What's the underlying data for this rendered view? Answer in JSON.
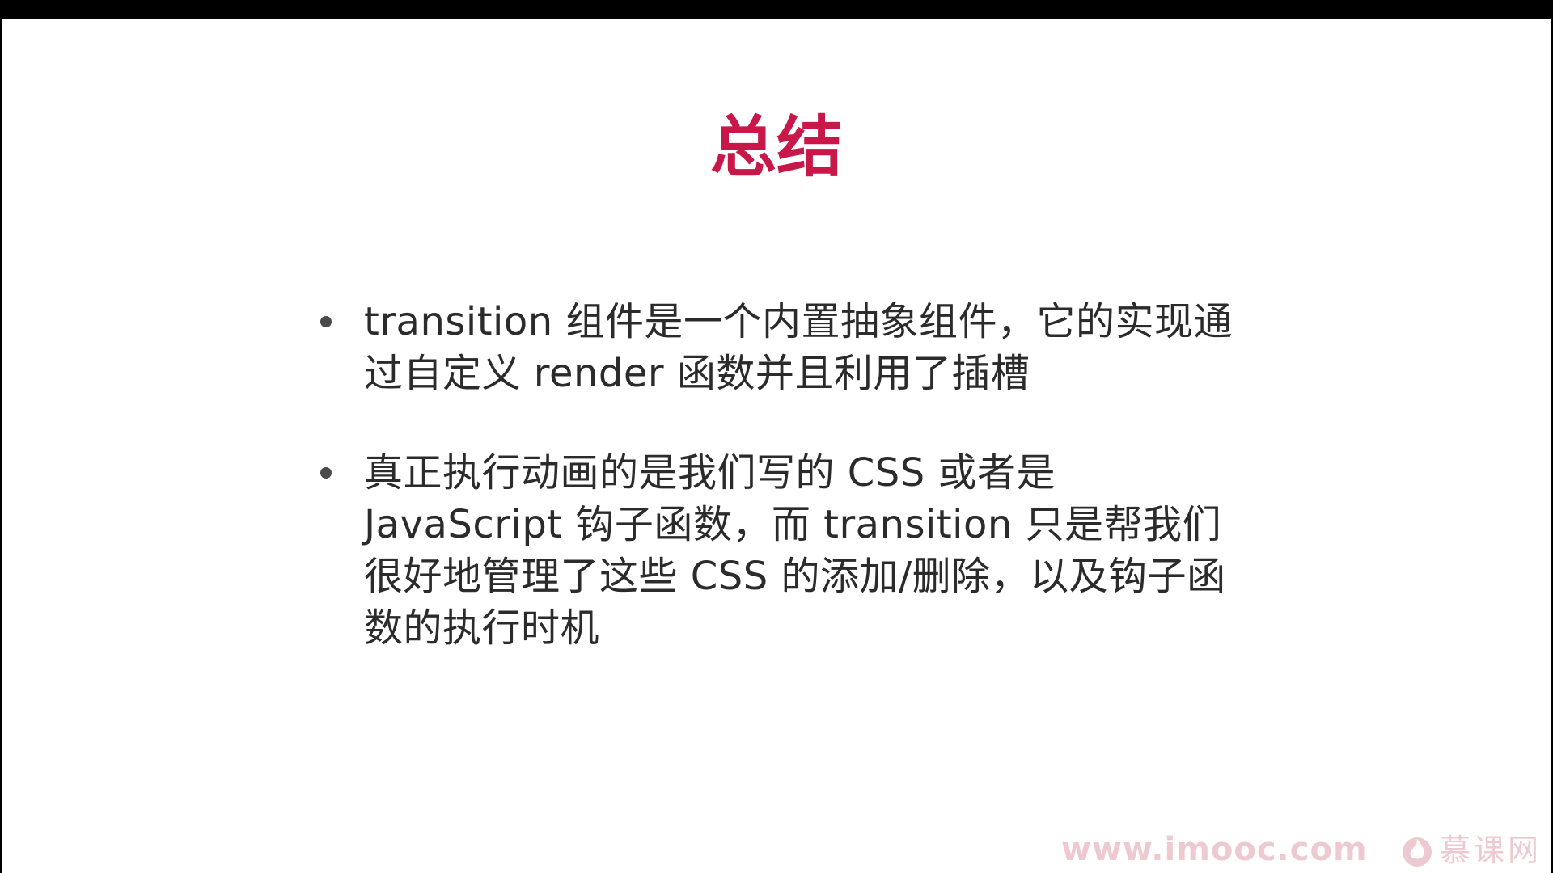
{
  "colors": {
    "title": "#c8184a",
    "body_text": "#2b2b2b",
    "bullet": "#4a4a4a",
    "watermark": "#e0a0a8"
  },
  "slide": {
    "title": "总结",
    "bullets": [
      {
        "lines": [
          "transition 组件是一个内置抽象组件，它的实现通",
          "过自定义 render 函数并且利用了插槽"
        ]
      },
      {
        "lines": [
          "真正执行动画的是我们写的 CSS 或者是",
          "JavaScript 钩子函数，而  transition 只是帮我们",
          "很好地管理了这些 CSS 的添加/删除，以及钩子函",
          "数的执行时机"
        ]
      }
    ]
  },
  "footer": {
    "url": "www.imooc.com",
    "brand": "慕课网",
    "logo_icon": "flame-icon"
  }
}
